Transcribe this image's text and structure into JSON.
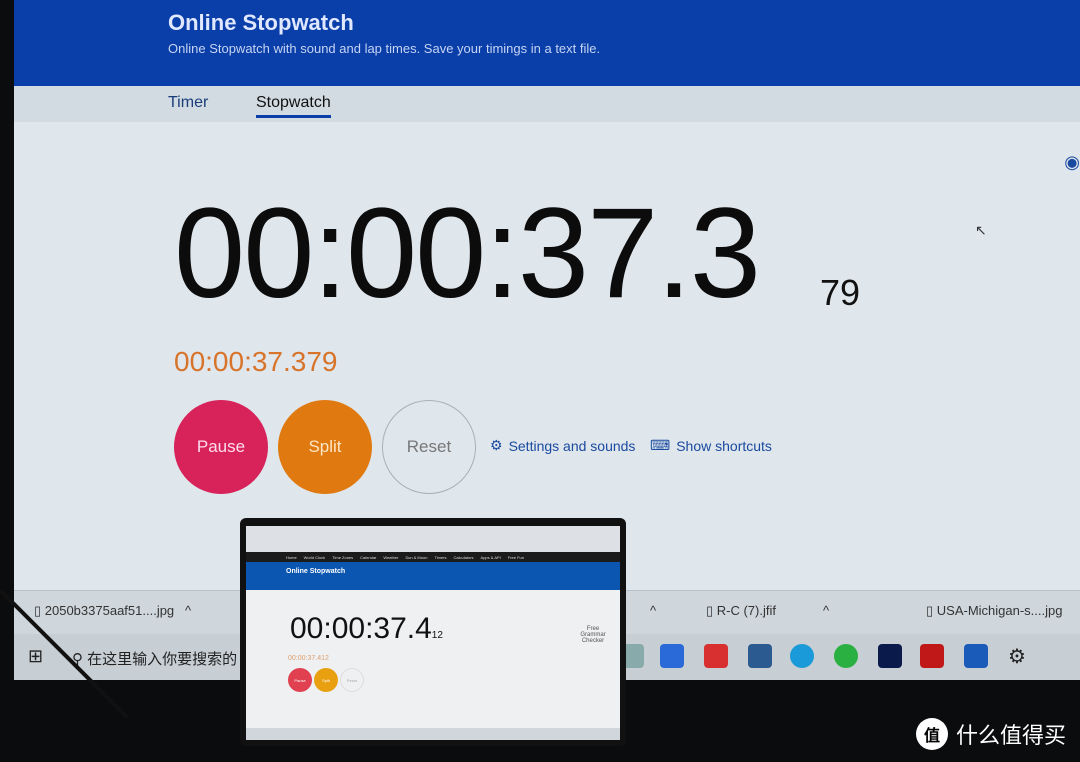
{
  "header": {
    "title": "Online Stopwatch",
    "subtitle": "Online Stopwatch with sound and lap times. Save your timings in a text file."
  },
  "tabs": [
    {
      "label": "Timer"
    },
    {
      "label": "Stopwatch",
      "active": true
    }
  ],
  "stopwatch": {
    "main": "00:00:37.3",
    "ms": "79",
    "lap": "00:00:37.379"
  },
  "buttons": {
    "pause": "Pause",
    "split": "Split",
    "reset": "Reset",
    "settings": "Settings and sounds",
    "shortcuts": "Show shortcuts"
  },
  "colors": {
    "header": "#0a3ea8",
    "pause": "#d8225a",
    "split": "#e07a10",
    "lap_text": "#d8742a"
  },
  "downloads": [
    {
      "name": "2050b3375aaf51....jpg"
    },
    {
      "name": "R-C (7).jfif"
    },
    {
      "name": "USA-Michigan-s....jpg"
    }
  ],
  "taskbar": {
    "search_placeholder": "在这里输入你要搜索的"
  },
  "laptop": {
    "nav": [
      "Home",
      "World Clock",
      "Time Zones",
      "Calendar",
      "Weather",
      "Sun & Moon",
      "Timers",
      "Calculators",
      "Apps & API",
      "Free Fun"
    ],
    "title": "Online Stopwatch",
    "main": "00:00:37.4",
    "ms": "12",
    "lap": "00:00:37.412",
    "pause": "Pause",
    "split": "Split",
    "reset": "Reset",
    "ad": "Free Grammar Checker"
  },
  "watermark": {
    "logo": "值",
    "text": "什么值得买"
  }
}
